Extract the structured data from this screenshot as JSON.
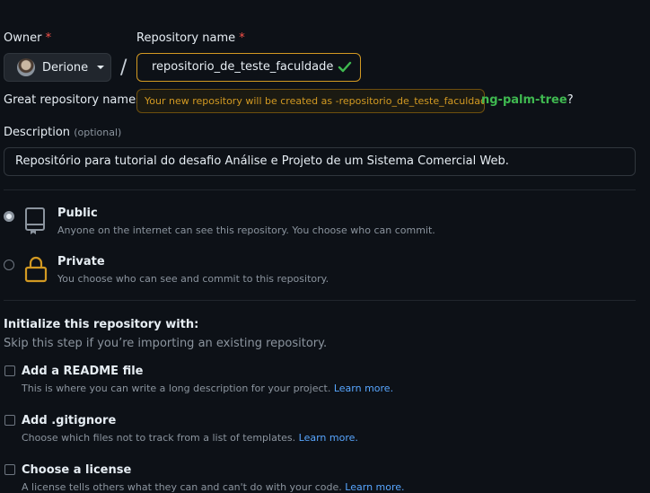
{
  "owner": {
    "label": "Owner",
    "required_mark": "*",
    "value": "Derione"
  },
  "repo": {
    "label": "Repository name",
    "required_mark": "*",
    "value": "repositorio_de_teste_faculdade",
    "tooltip": "Your new repository will be created as -repositorio_de_teste_faculdade.",
    "hint_prefix": "Great repository names",
    "suggestion": "ng-palm-tree",
    "suggestion_suffix": "?"
  },
  "description": {
    "label": "Description",
    "optional": "(optional)",
    "value": "Repositório para tutorial do desafio Análise e Projeto de um Sistema Comercial Web."
  },
  "visibility": {
    "public": {
      "title": "Public",
      "desc": "Anyone on the internet can see this repository. You choose who can commit."
    },
    "private": {
      "title": "Private",
      "desc": "You choose who can see and commit to this repository."
    }
  },
  "init": {
    "title": "Initialize this repository with:",
    "subtitle": "Skip this step if you’re importing an existing repository.",
    "readme": {
      "title": "Add a README file",
      "desc": "This is where you can write a long description for your project.",
      "link": "Learn more."
    },
    "gitignore": {
      "title": "Add .gitignore",
      "desc": "Choose which files not to track from a list of templates.",
      "link": "Learn more."
    },
    "license": {
      "title": "Choose a license",
      "desc": "A license tells others what they can and can't do with your code.",
      "link": "Learn more."
    }
  },
  "colors": {
    "accent_warning": "#d29922",
    "success": "#3fb950",
    "link": "#58a6ff",
    "bg": "#0d1117"
  }
}
